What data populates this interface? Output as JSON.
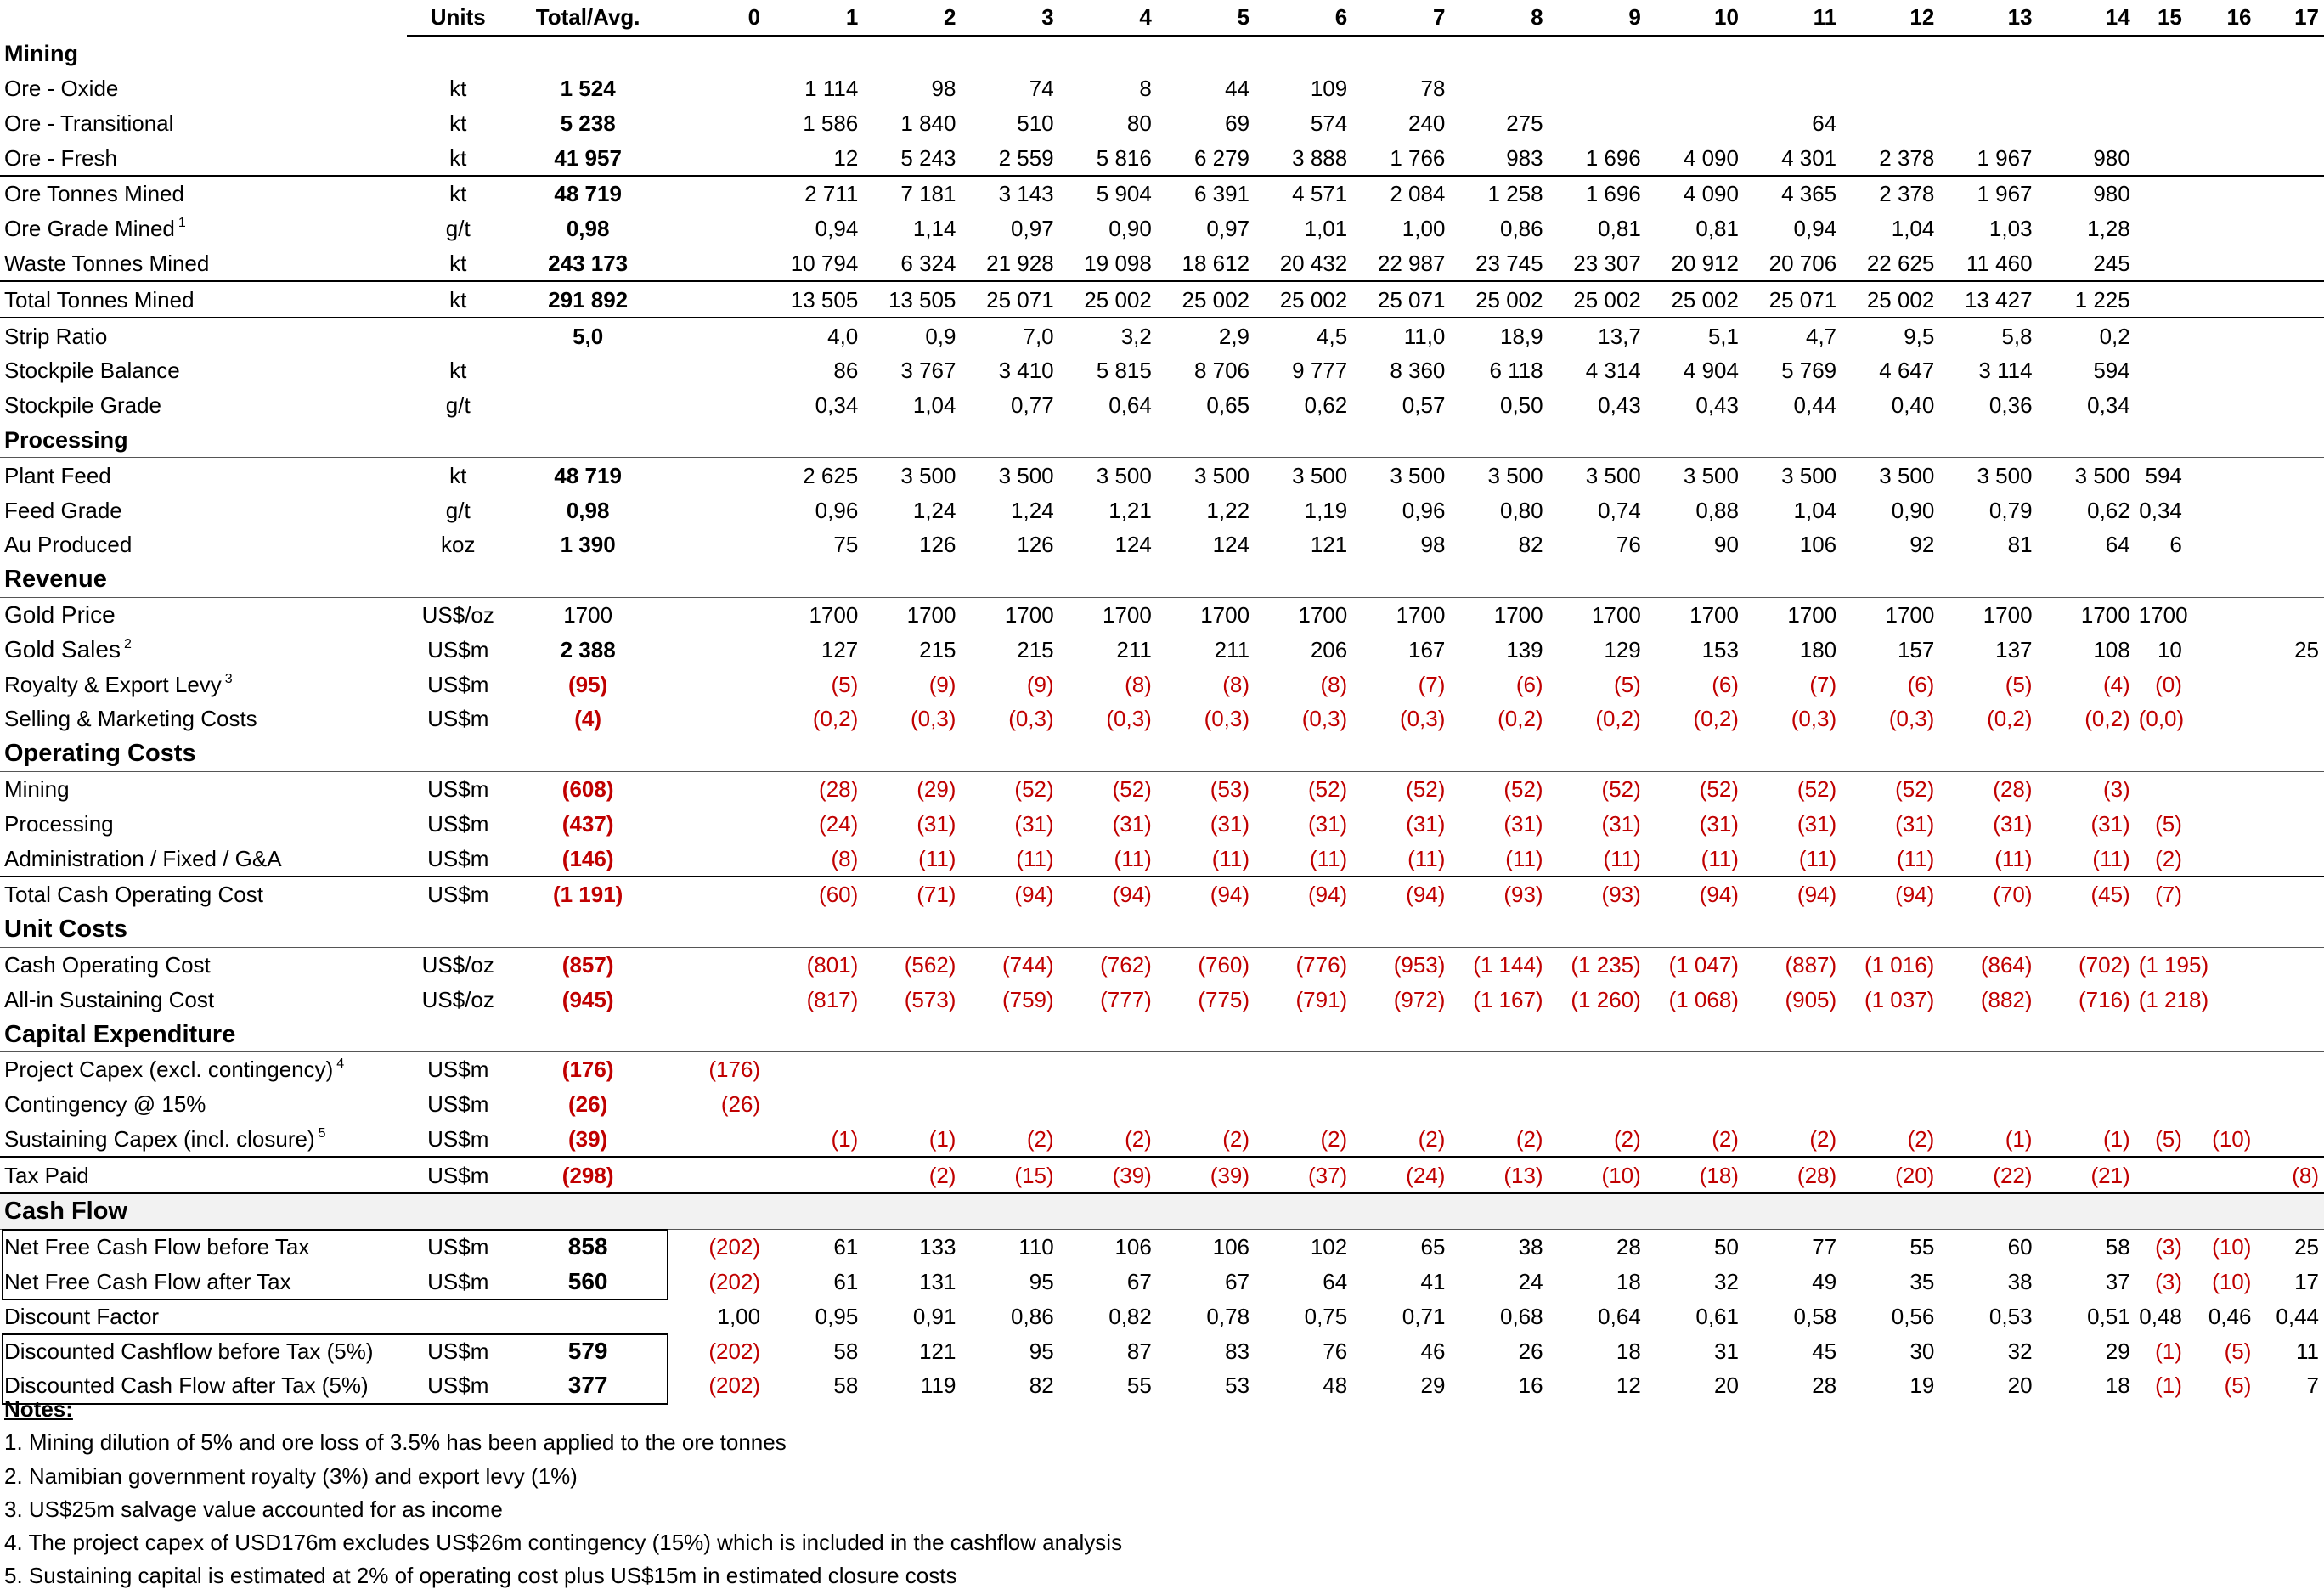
{
  "header": {
    "units": "Units",
    "total": "Total/Avg.",
    "years": [
      "0",
      "1",
      "2",
      "3",
      "4",
      "5",
      "6",
      "7",
      "8",
      "9",
      "10",
      "11",
      "12",
      "13",
      "14",
      "15",
      "16",
      "17"
    ]
  },
  "rows": [
    {
      "type": "section",
      "label": "Mining"
    },
    {
      "type": "row",
      "label": "Ore - Oxide",
      "unit": "kt",
      "total": "1 524",
      "vals": [
        "",
        "1 114",
        "98",
        "74",
        "8",
        "44",
        "109",
        "78",
        "",
        "",
        "",
        "",
        "",
        "",
        "",
        "",
        "",
        ""
      ]
    },
    {
      "type": "row",
      "label": "Ore - Transitional",
      "unit": "kt",
      "total": "5 238",
      "vals": [
        "",
        "1 586",
        "1 840",
        "510",
        "80",
        "69",
        "574",
        "240",
        "275",
        "",
        "",
        "64",
        "",
        "",
        "",
        "",
        "",
        ""
      ]
    },
    {
      "type": "row",
      "label": "Ore - Fresh",
      "unit": "kt",
      "total": "41 957",
      "vals": [
        "",
        "12",
        "5 243",
        "2 559",
        "5 816",
        "6 279",
        "3 888",
        "1 766",
        "983",
        "1 696",
        "4 090",
        "4 301",
        "2 378",
        "1 967",
        "980",
        "",
        "",
        ""
      ]
    },
    {
      "type": "row",
      "label": "Ore Tonnes Mined",
      "unit": "kt",
      "total": "48 719",
      "vals": [
        "",
        "2 711",
        "7 181",
        "3 143",
        "5 904",
        "6 391",
        "4 571",
        "2 084",
        "1 258",
        "1 696",
        "4 090",
        "4 365",
        "2 378",
        "1 967",
        "980",
        "",
        "",
        ""
      ],
      "topline": true
    },
    {
      "type": "row",
      "label": "Ore Grade Mined",
      "sup": "1",
      "unit": "g/t",
      "total": "0,98",
      "vals": [
        "",
        "0,94",
        "1,14",
        "0,97",
        "0,90",
        "0,97",
        "1,01",
        "1,00",
        "0,86",
        "0,81",
        "0,81",
        "0,94",
        "1,04",
        "1,03",
        "1,28",
        "",
        "",
        ""
      ]
    },
    {
      "type": "row",
      "label": "Waste Tonnes Mined",
      "unit": "kt",
      "total": "243 173",
      "vals": [
        "",
        "10 794",
        "6 324",
        "21 928",
        "19 098",
        "18 612",
        "20 432",
        "22 987",
        "23 745",
        "23 307",
        "20 912",
        "20 706",
        "22 625",
        "11 460",
        "245",
        "",
        "",
        ""
      ]
    },
    {
      "type": "row",
      "label": "Total Tonnes Mined",
      "unit": "kt",
      "total": "291 892",
      "vals": [
        "",
        "13 505",
        "13 505",
        "25 071",
        "25 002",
        "25 002",
        "25 002",
        "25 071",
        "25 002",
        "25 002",
        "25 002",
        "25 071",
        "25 002",
        "13 427",
        "1 225",
        "",
        "",
        ""
      ],
      "topline": true
    },
    {
      "type": "row",
      "label": "Strip Ratio",
      "unit": "",
      "total": "5,0",
      "vals": [
        "",
        "4,0",
        "0,9",
        "7,0",
        "3,2",
        "2,9",
        "4,5",
        "11,0",
        "18,9",
        "13,7",
        "5,1",
        "4,7",
        "9,5",
        "5,8",
        "0,2",
        "",
        "",
        ""
      ],
      "topline": true
    },
    {
      "type": "row",
      "label": "Stockpile Balance",
      "unit": "kt",
      "total": "",
      "vals": [
        "",
        "86",
        "3 767",
        "3 410",
        "5 815",
        "8 706",
        "9 777",
        "8 360",
        "6 118",
        "4 314",
        "4 904",
        "5 769",
        "4 647",
        "3 114",
        "594",
        "",
        "",
        ""
      ]
    },
    {
      "type": "row",
      "label": "Stockpile Grade",
      "unit": "g/t",
      "total": "",
      "vals": [
        "",
        "0,34",
        "1,04",
        "0,77",
        "0,64",
        "0,65",
        "0,62",
        "0,57",
        "0,50",
        "0,43",
        "0,43",
        "0,44",
        "0,40",
        "0,36",
        "0,34",
        "",
        "",
        ""
      ]
    },
    {
      "type": "section",
      "label": "Processing",
      "line": true
    },
    {
      "type": "row",
      "label": "Plant Feed",
      "unit": "kt",
      "total": "48 719",
      "vals": [
        "",
        "2 625",
        "3 500",
        "3 500",
        "3 500",
        "3 500",
        "3 500",
        "3 500",
        "3 500",
        "3 500",
        "3 500",
        "3 500",
        "3 500",
        "3 500",
        "3 500",
        "594",
        "",
        ""
      ]
    },
    {
      "type": "row",
      "label": "Feed Grade",
      "unit": "g/t",
      "total": "0,98",
      "vals": [
        "",
        "0,96",
        "1,24",
        "1,24",
        "1,21",
        "1,22",
        "1,19",
        "0,96",
        "0,80",
        "0,74",
        "0,88",
        "1,04",
        "0,90",
        "0,79",
        "0,62",
        "0,34",
        "",
        ""
      ]
    },
    {
      "type": "row",
      "label": "Au Produced",
      "unit": "koz",
      "total": "1 390",
      "vals": [
        "",
        "75",
        "126",
        "126",
        "124",
        "124",
        "121",
        "98",
        "82",
        "76",
        "90",
        "106",
        "92",
        "81",
        "64",
        "6",
        "",
        ""
      ]
    },
    {
      "type": "section",
      "label": "Revenue",
      "big": true,
      "line": true
    },
    {
      "type": "row",
      "label": "Gold Price",
      "unit": "US$/oz",
      "total": "1700",
      "plain": true,
      "biglabel": true,
      "vals": [
        "",
        "1700",
        "1700",
        "1700",
        "1700",
        "1700",
        "1700",
        "1700",
        "1700",
        "1700",
        "1700",
        "1700",
        "1700",
        "1700",
        "1700",
        "1700",
        "",
        ""
      ]
    },
    {
      "type": "row",
      "label": "Gold Sales",
      "sup": "2",
      "unit": "US$m",
      "total": "2 388",
      "biglabel": true,
      "vals": [
        "",
        "127",
        "215",
        "215",
        "211",
        "211",
        "206",
        "167",
        "139",
        "129",
        "153",
        "180",
        "157",
        "137",
        "108",
        "10",
        "",
        "25"
      ]
    },
    {
      "type": "row",
      "label": "Royalty & Export Levy",
      "sup": "3",
      "unit": "US$m",
      "total": "(95)",
      "neg": true,
      "vals": [
        "",
        "(5)",
        "(9)",
        "(9)",
        "(8)",
        "(8)",
        "(8)",
        "(7)",
        "(6)",
        "(5)",
        "(6)",
        "(7)",
        "(6)",
        "(5)",
        "(4)",
        "(0)",
        "",
        ""
      ]
    },
    {
      "type": "row",
      "label": "Selling & Marketing Costs",
      "unit": "US$m",
      "total": "(4)",
      "neg": true,
      "vals": [
        "",
        "(0,2)",
        "(0,3)",
        "(0,3)",
        "(0,3)",
        "(0,3)",
        "(0,3)",
        "(0,3)",
        "(0,2)",
        "(0,2)",
        "(0,2)",
        "(0,3)",
        "(0,3)",
        "(0,2)",
        "(0,2)",
        "(0,0)",
        "",
        ""
      ]
    },
    {
      "type": "section",
      "label": "Operating Costs",
      "big": true,
      "line": true
    },
    {
      "type": "row",
      "label": "Mining",
      "unit": "US$m",
      "total": "(608)",
      "neg": true,
      "vals": [
        "",
        "(28)",
        "(29)",
        "(52)",
        "(52)",
        "(53)",
        "(52)",
        "(52)",
        "(52)",
        "(52)",
        "(52)",
        "(52)",
        "(52)",
        "(28)",
        "(3)",
        "",
        "",
        ""
      ]
    },
    {
      "type": "row",
      "label": "Processing",
      "unit": "US$m",
      "total": "(437)",
      "neg": true,
      "vals": [
        "",
        "(24)",
        "(31)",
        "(31)",
        "(31)",
        "(31)",
        "(31)",
        "(31)",
        "(31)",
        "(31)",
        "(31)",
        "(31)",
        "(31)",
        "(31)",
        "(31)",
        "(5)",
        "",
        ""
      ]
    },
    {
      "type": "row",
      "label": "Administration / Fixed / G&A",
      "unit": "US$m",
      "total": "(146)",
      "neg": true,
      "vals": [
        "",
        "(8)",
        "(11)",
        "(11)",
        "(11)",
        "(11)",
        "(11)",
        "(11)",
        "(11)",
        "(11)",
        "(11)",
        "(11)",
        "(11)",
        "(11)",
        "(11)",
        "(2)",
        "",
        ""
      ]
    },
    {
      "type": "row",
      "label": "Total Cash Operating Cost",
      "unit": "US$m",
      "total": "(1 191)",
      "neg": true,
      "topline": true,
      "vals": [
        "",
        "(60)",
        "(71)",
        "(94)",
        "(94)",
        "(94)",
        "(94)",
        "(94)",
        "(93)",
        "(93)",
        "(94)",
        "(94)",
        "(94)",
        "(70)",
        "(45)",
        "(7)",
        "",
        ""
      ]
    },
    {
      "type": "section",
      "label": "Unit Costs",
      "big": true,
      "line": true
    },
    {
      "type": "row",
      "label": "Cash Operating Cost",
      "unit": "US$/oz",
      "total": "(857)",
      "neg": true,
      "vals": [
        "",
        "(801)",
        "(562)",
        "(744)",
        "(762)",
        "(760)",
        "(776)",
        "(953)",
        "(1 144)",
        "(1 235)",
        "(1 047)",
        "(887)",
        "(1 016)",
        "(864)",
        "(702)",
        "(1 195)",
        "",
        ""
      ]
    },
    {
      "type": "row",
      "label": "All-in Sustaining Cost",
      "unit": "US$/oz",
      "total": "(945)",
      "neg": true,
      "vals": [
        "",
        "(817)",
        "(573)",
        "(759)",
        "(777)",
        "(775)",
        "(791)",
        "(972)",
        "(1 167)",
        "(1 260)",
        "(1 068)",
        "(905)",
        "(1 037)",
        "(882)",
        "(716)",
        "(1 218)",
        "",
        ""
      ]
    },
    {
      "type": "section",
      "label": "Capital Expenditure",
      "big": true,
      "line": true
    },
    {
      "type": "row",
      "label": "Project Capex (excl. contingency)",
      "sup": "4",
      "unit": "US$m",
      "total": "(176)",
      "neg": true,
      "vals": [
        "(176)",
        "",
        "",
        "",
        "",
        "",
        "",
        "",
        "",
        "",
        "",
        "",
        "",
        "",
        "",
        "",
        "",
        ""
      ]
    },
    {
      "type": "row",
      "label": "Contingency @ 15%",
      "unit": "US$m",
      "total": "(26)",
      "neg": true,
      "vals": [
        "(26)",
        "",
        "",
        "",
        "",
        "",
        "",
        "",
        "",
        "",
        "",
        "",
        "",
        "",
        "",
        "",
        "",
        ""
      ]
    },
    {
      "type": "row",
      "label": "Sustaining Capex (incl. closure)",
      "sup": "5",
      "unit": "US$m",
      "total": "(39)",
      "neg": true,
      "vals": [
        "",
        "(1)",
        "(1)",
        "(2)",
        "(2)",
        "(2)",
        "(2)",
        "(2)",
        "(2)",
        "(2)",
        "(2)",
        "(2)",
        "(2)",
        "(1)",
        "(1)",
        "(5)",
        "(10)",
        ""
      ]
    },
    {
      "type": "row",
      "label": "Tax Paid",
      "unit": "US$m",
      "total": "(298)",
      "neg": true,
      "topline": true,
      "vals": [
        "",
        "",
        "(2)",
        "(15)",
        "(39)",
        "(39)",
        "(37)",
        "(24)",
        "(13)",
        "(10)",
        "(18)",
        "(28)",
        "(20)",
        "(22)",
        "(21)",
        "",
        "",
        "(8)"
      ]
    },
    {
      "type": "section",
      "label": "Cash Flow",
      "big": true,
      "boxed": true,
      "topline": true,
      "line": true
    },
    {
      "type": "row",
      "label": "Net Free Cash Flow before Tax",
      "unit": "US$m",
      "total": "858",
      "cash": true,
      "vals": [
        "(202)",
        "61",
        "133",
        "110",
        "106",
        "106",
        "102",
        "65",
        "38",
        "28",
        "50",
        "77",
        "55",
        "60",
        "58",
        "(3)",
        "(10)",
        "25"
      ]
    },
    {
      "type": "row",
      "label": "Net Free Cash Flow after Tax",
      "unit": "US$m",
      "total": "560",
      "cash": true,
      "vals": [
        "(202)",
        "61",
        "131",
        "95",
        "67",
        "67",
        "64",
        "41",
        "24",
        "18",
        "32",
        "49",
        "35",
        "38",
        "37",
        "(3)",
        "(10)",
        "17"
      ]
    },
    {
      "type": "row",
      "label": "Discount Factor",
      "unit": "",
      "total": "",
      "vals": [
        "1,00",
        "0,95",
        "0,91",
        "0,86",
        "0,82",
        "0,78",
        "0,75",
        "0,71",
        "0,68",
        "0,64",
        "0,61",
        "0,58",
        "0,56",
        "0,53",
        "0,51",
        "0,48",
        "0,46",
        "0,44"
      ]
    },
    {
      "type": "row",
      "label": "Discounted Cashflow before Tax (5%)",
      "unit": "US$m",
      "total": "579",
      "cash": true,
      "vals": [
        "(202)",
        "58",
        "121",
        "95",
        "87",
        "83",
        "76",
        "46",
        "26",
        "18",
        "31",
        "45",
        "30",
        "32",
        "29",
        "(1)",
        "(5)",
        "11"
      ]
    },
    {
      "type": "row",
      "label": "Discounted Cash Flow after Tax (5%)",
      "unit": "US$m",
      "total": "377",
      "cash": true,
      "vals": [
        "(202)",
        "58",
        "119",
        "82",
        "55",
        "53",
        "48",
        "29",
        "16",
        "12",
        "20",
        "28",
        "19",
        "20",
        "18",
        "(1)",
        "(5)",
        "7"
      ]
    }
  ],
  "notes": {
    "title": "Notes:",
    "items": [
      "1. Mining dilution of 5% and ore loss of 3.5% has been applied to the ore tonnes",
      "2. Namibian government royalty (3%) and export levy (1%)",
      "3. US$25m salvage value accounted for as income",
      "4. The project capex of USD176m excludes US$26m contingency (15%) which is included in the cashflow analysis",
      "5. Sustaining capital is estimated at 2% of operating cost plus US$15m in estimated closure costs"
    ]
  }
}
